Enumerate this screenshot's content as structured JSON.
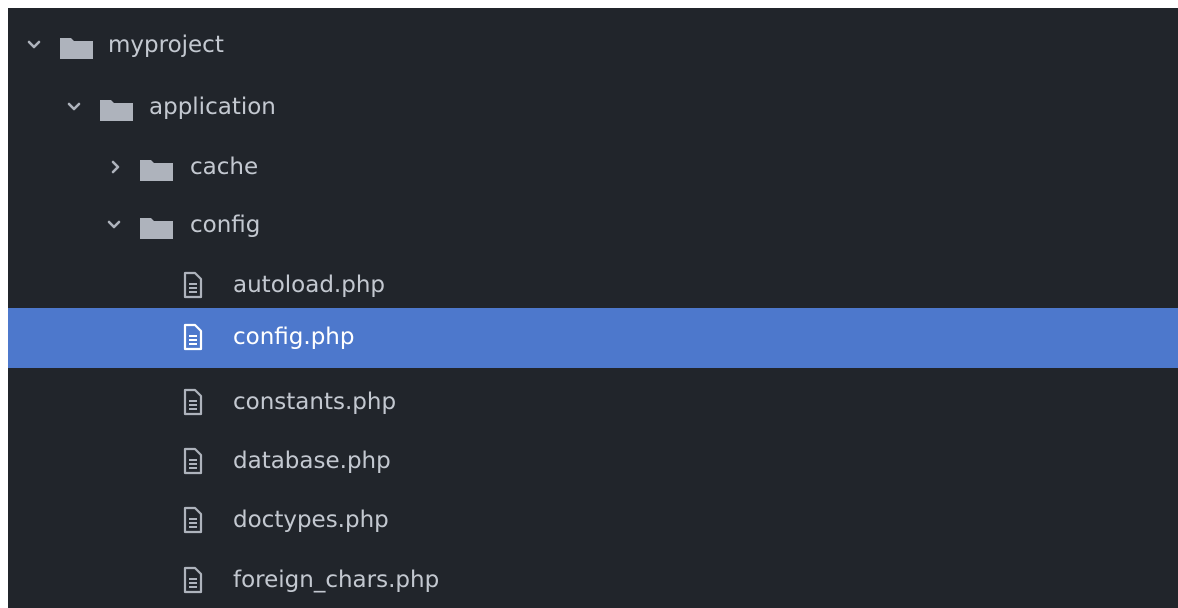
{
  "tree": {
    "root": {
      "label": "myproject",
      "expanded": true
    },
    "application": {
      "label": "application",
      "expanded": true
    },
    "cache": {
      "label": "cache",
      "expanded": false
    },
    "config": {
      "label": "config",
      "expanded": true
    },
    "files": [
      {
        "label": "autoload.php",
        "selected": false
      },
      {
        "label": "config.php",
        "selected": true
      },
      {
        "label": "constants.php",
        "selected": false
      },
      {
        "label": "database.php",
        "selected": false
      },
      {
        "label": "doctypes.php",
        "selected": false
      },
      {
        "label": "foreign_chars.php",
        "selected": false
      }
    ]
  },
  "icons": {
    "expanded_chevron": "chevron-down-icon",
    "collapsed_chevron": "chevron-right-icon",
    "folder": "folder-icon",
    "file": "file-icon"
  },
  "colors": {
    "background": "#21252b",
    "text": "#c3c8d0",
    "selected_background": "#4d78cc",
    "selected_text": "#ffffff",
    "icon": "#aeb3bc"
  }
}
